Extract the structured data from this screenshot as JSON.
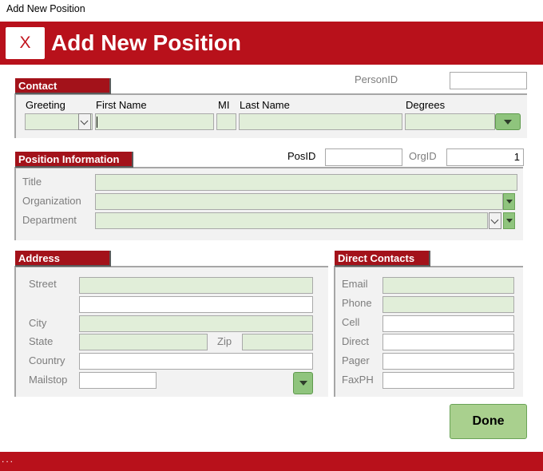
{
  "window": {
    "title": "Add New Position"
  },
  "header": {
    "logo_text": "X",
    "title": "Add New Position"
  },
  "contact": {
    "section_label": "Contact",
    "person_id_label": "PersonID",
    "person_id_value": "",
    "greeting_label": "Greeting",
    "first_name_label": "First Name",
    "mi_label": "MI",
    "last_name_label": "Last Name",
    "degrees_label": "Degrees"
  },
  "position": {
    "section_label": "Position Information",
    "pos_id_label": "PosID",
    "pos_id_value": "",
    "org_id_label": "OrgID",
    "org_id_value": "1",
    "title_label": "Title",
    "organization_label": "Organization",
    "department_label": "Department"
  },
  "address": {
    "section_label": "Address",
    "street_label": "Street",
    "city_label": "City",
    "state_label": "State",
    "zip_label": "Zip",
    "country_label": "Country",
    "mailstop_label": "Mailstop"
  },
  "direct_contacts": {
    "section_label": "Direct Contacts",
    "email_label": "Email",
    "phone_label": "Phone",
    "cell_label": "Cell",
    "direct_label": "Direct",
    "pager_label": "Pager",
    "faxph_label": "FaxPH"
  },
  "actions": {
    "done_label": "Done"
  },
  "footer": {
    "status_text": "..."
  },
  "colors": {
    "brand_red": "#b8111b",
    "section_tab_red": "#a3121a",
    "field_green": "#e1eed9",
    "button_green": "#a9d08e",
    "panel_grey": "#f2f2f2"
  },
  "icons": {
    "logo": "close-x-icon",
    "dropdown": "chevron-down-icon",
    "combo_arrow": "triangle-down-icon"
  }
}
